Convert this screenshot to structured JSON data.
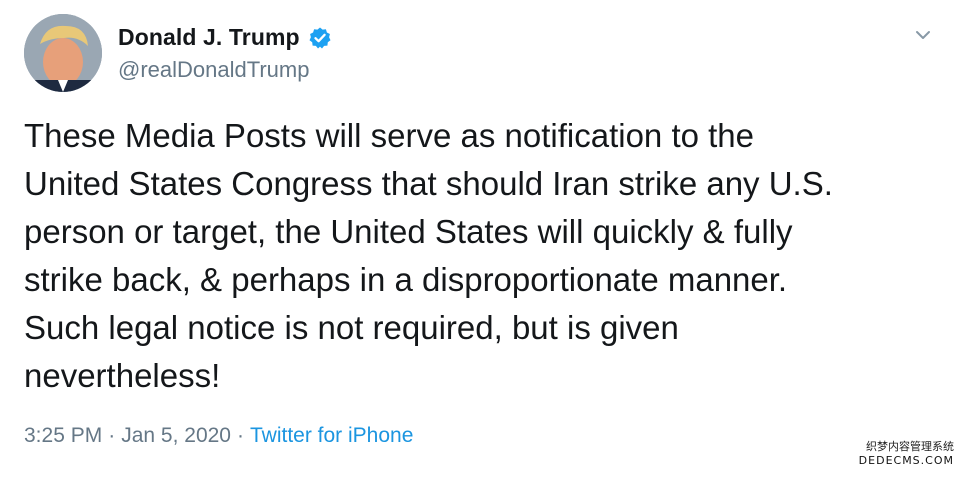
{
  "user": {
    "display_name": "Donald J. Trump",
    "handle": "@realDonaldTrump",
    "verified": true
  },
  "tweet": {
    "lines": [
      "These Media Posts will serve as notification to the",
      "United States Congress that should Iran strike any U.S.",
      "person or target, the United States will quickly & fully",
      "strike back, & perhaps in a disproportionate manner.",
      "Such legal notice is not required, but is given",
      "nevertheless!"
    ],
    "time": "3:25 PM",
    "date": "Jan 5, 2020",
    "separator": "·",
    "source": "Twitter for iPhone"
  },
  "watermark": {
    "line1": "织梦内容管理系统",
    "line2": "DEDECMS.COM"
  },
  "colors": {
    "text": "#14171a",
    "secondary": "#657786",
    "link": "#1b95e0",
    "verified_badge": "#1da1f2"
  },
  "icons": {
    "verified": "verified-badge-icon",
    "menu": "chevron-down-icon"
  }
}
